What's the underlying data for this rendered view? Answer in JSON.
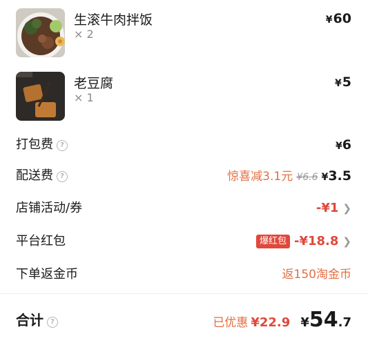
{
  "items": [
    {
      "name": "生滚牛肉拌饭",
      "qty": "× 2",
      "currency": "¥",
      "price": "60"
    },
    {
      "name": "老豆腐",
      "qty": "× 1",
      "currency": "¥",
      "price": "5"
    }
  ],
  "fees": {
    "packaging": {
      "label": "打包费",
      "currency": "¥",
      "amount": "6"
    },
    "delivery": {
      "label": "配送费",
      "promo": "惊喜减3.1元",
      "original": "¥6.6",
      "currency": "¥",
      "amount": "3.5"
    },
    "store_coupon": {
      "label": "店铺活动/券",
      "amount": "-¥1"
    },
    "platform_redpacket": {
      "label": "平台红包",
      "badge": "爆红包",
      "amount": "-¥18.8"
    },
    "coins": {
      "label": "下单返金币",
      "value": "返150淘金币"
    }
  },
  "total": {
    "label": "合计",
    "saved_label": "已优惠",
    "saved_amount": "¥22.9",
    "currency": "¥",
    "amount_int": "54",
    "amount_dec": ".7"
  },
  "colors": {
    "accent_red": "#e0483b",
    "promo_orange": "#e07044"
  }
}
